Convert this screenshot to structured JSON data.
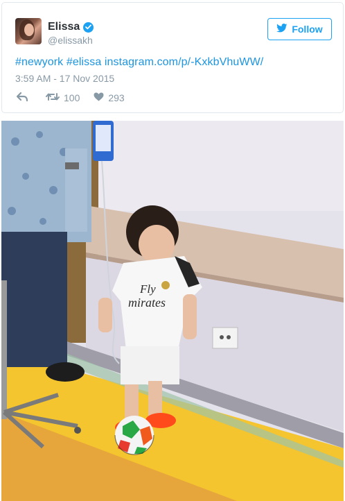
{
  "user": {
    "display_name": "Elissa",
    "handle": "@elissakh",
    "verified": true
  },
  "follow_button": {
    "label": "Follow"
  },
  "tweet": {
    "hashtag_1": "#newyork",
    "hashtag_2": "#elissa",
    "link": "instagram.com/p/-KxkbVhuWW/",
    "timestamp": "3:59 AM - 17 Nov 2015"
  },
  "actions": {
    "retweet_count": "100",
    "like_count": "293"
  },
  "photo": {
    "jersey_text_line1": "Fly",
    "jersey_text_line2": "mirates"
  },
  "colors": {
    "twitter_blue": "#1da1f2",
    "link_blue": "#1b95e0",
    "muted_gray": "#8899a6"
  }
}
